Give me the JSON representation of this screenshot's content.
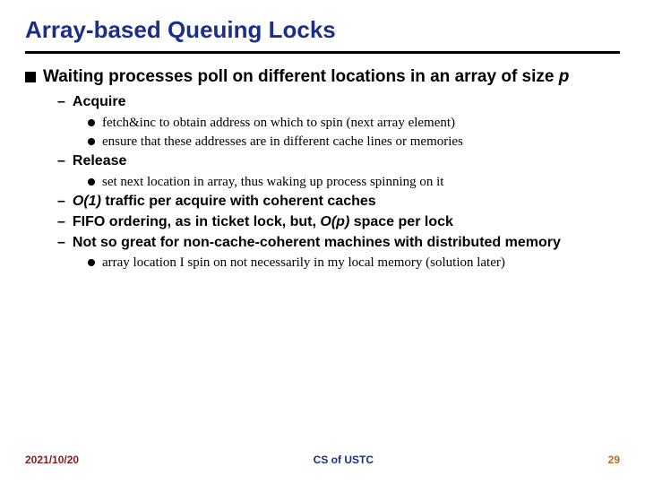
{
  "title": "Array-based Queuing Locks",
  "main_line_prefix": "Waiting processes poll on different locations in an array of size ",
  "main_line_var": "p",
  "acquire_label": "Acquire",
  "acquire_b1": "fetch&inc to obtain address on which to spin (next array element)",
  "acquire_b2": "ensure that these addresses are in different cache lines or memories",
  "release_label": "Release",
  "release_b1": "set next location in array, thus waking up process spinning on it",
  "o1_var": "O(1)",
  "o1_suffix": " traffic per acquire with coherent caches",
  "fifo_prefix": "FIFO ordering, as in ticket lock, but, ",
  "op_var": "O(p)",
  "fifo_suffix": " space per lock",
  "ncc_text": "Not so great for non-cache-coherent machines with distributed memory",
  "ncc_b1": "array location  I spin on not necessarily in my local memory (solution later)",
  "footer": {
    "date": "2021/10/20",
    "center": "CS of USTC",
    "page": "29"
  }
}
